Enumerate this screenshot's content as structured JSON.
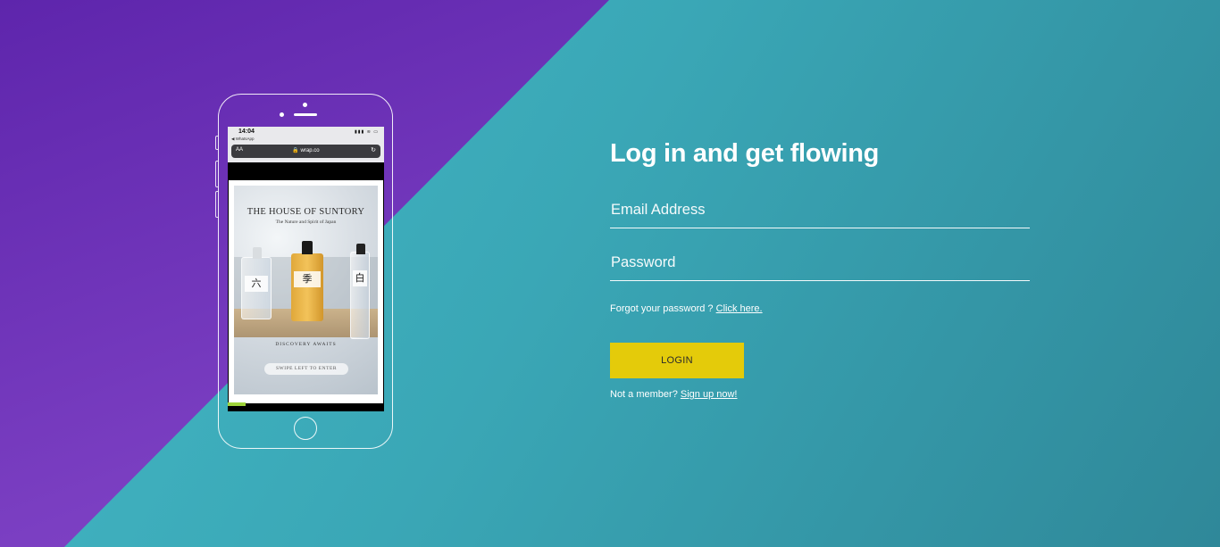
{
  "phone": {
    "status_time": "14:04",
    "status_back": "◀ WhatsApp",
    "status_icons": "▮▮▮ ≋ ▭",
    "url_aa": "AA",
    "url": "🔒 wrap.co",
    "reload_icon": "↻",
    "ad": {
      "title": "THE HOUSE OF SUNTORY",
      "subtitle": "The Nature and Spirit of Japan",
      "bottle_roku_label": "六",
      "bottle_toki_label": "季",
      "bottle_haku_label": "白",
      "discover": "DISCOVERY AWAITS",
      "swipe": "SWIPE LEFT TO ENTER"
    }
  },
  "form": {
    "title": "Log in and get flowing",
    "email_placeholder": "Email Address",
    "password_placeholder": "Password",
    "forgot_text": "Forgot your password ? ",
    "forgot_link": "Click here.",
    "login_label": "LOGIN",
    "signup_text": "Not a member? ",
    "signup_link": "Sign up now!"
  },
  "colors": {
    "teal": "#3aa7b6",
    "purple": "#6a2fb4",
    "login_button": "#e4cb0a"
  }
}
